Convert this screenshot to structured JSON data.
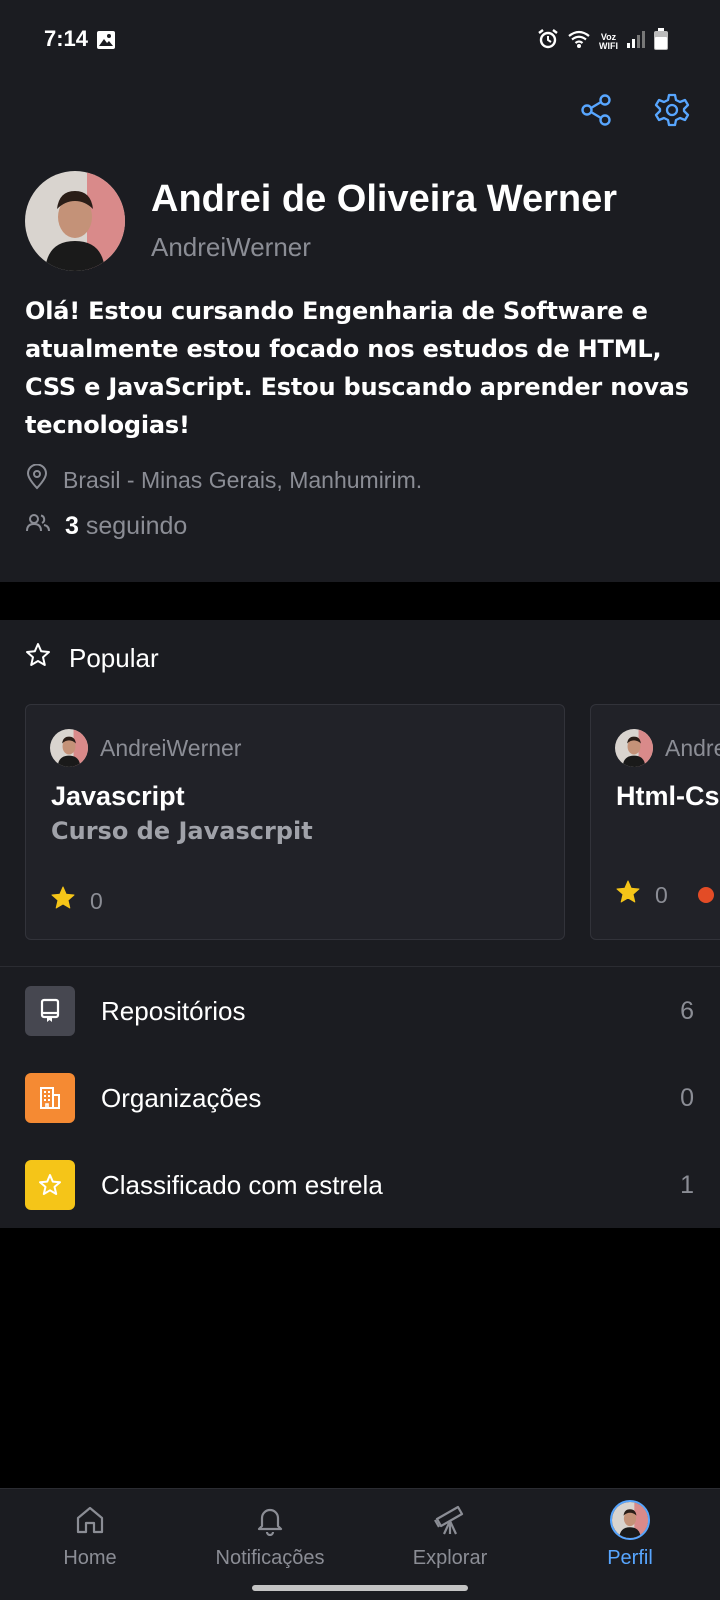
{
  "status_bar": {
    "time": "7:14",
    "voz_line1": "Voz",
    "voz_line2": "WIFI"
  },
  "profile": {
    "name": "Andrei de Oliveira Werner",
    "username": "AndreiWerner",
    "bio": "Olá! Estou cursando Engenharia de Software e atualmente estou focado nos estudos de HTML, CSS e JavaScript. Estou buscando aprender novas tecnologias!",
    "location": "Brasil - Minas Gerais, Manhumirim.",
    "following_count": "3",
    "following_label": "seguindo"
  },
  "popular": {
    "heading": "Popular",
    "cards": [
      {
        "owner": "AndreiWerner",
        "title": "Javascript",
        "description": "Curso de Javascrpit",
        "stars": "0"
      },
      {
        "owner": "AndreiWerner",
        "title": "Html-Css",
        "description": "",
        "stars": "0",
        "language_color": "#e34c26"
      }
    ]
  },
  "menu": [
    {
      "label": "Repositórios",
      "count": "6",
      "icon": "repo-icon",
      "color": "#464750"
    },
    {
      "label": "Organizações",
      "count": "0",
      "icon": "organization-icon",
      "color": "#f58a33"
    },
    {
      "label": "Classificado com estrela",
      "count": "1",
      "icon": "star-icon",
      "color": "#f5c518"
    }
  ],
  "nav": [
    {
      "label": "Home",
      "icon": "home-icon"
    },
    {
      "label": "Notificações",
      "icon": "bell-icon"
    },
    {
      "label": "Explorar",
      "icon": "telescope-icon"
    },
    {
      "label": "Perfil",
      "icon": "avatar",
      "active": true
    }
  ],
  "colors": {
    "accent": "#58a6ff",
    "background": "#1b1c21",
    "star": "#f5c518"
  }
}
